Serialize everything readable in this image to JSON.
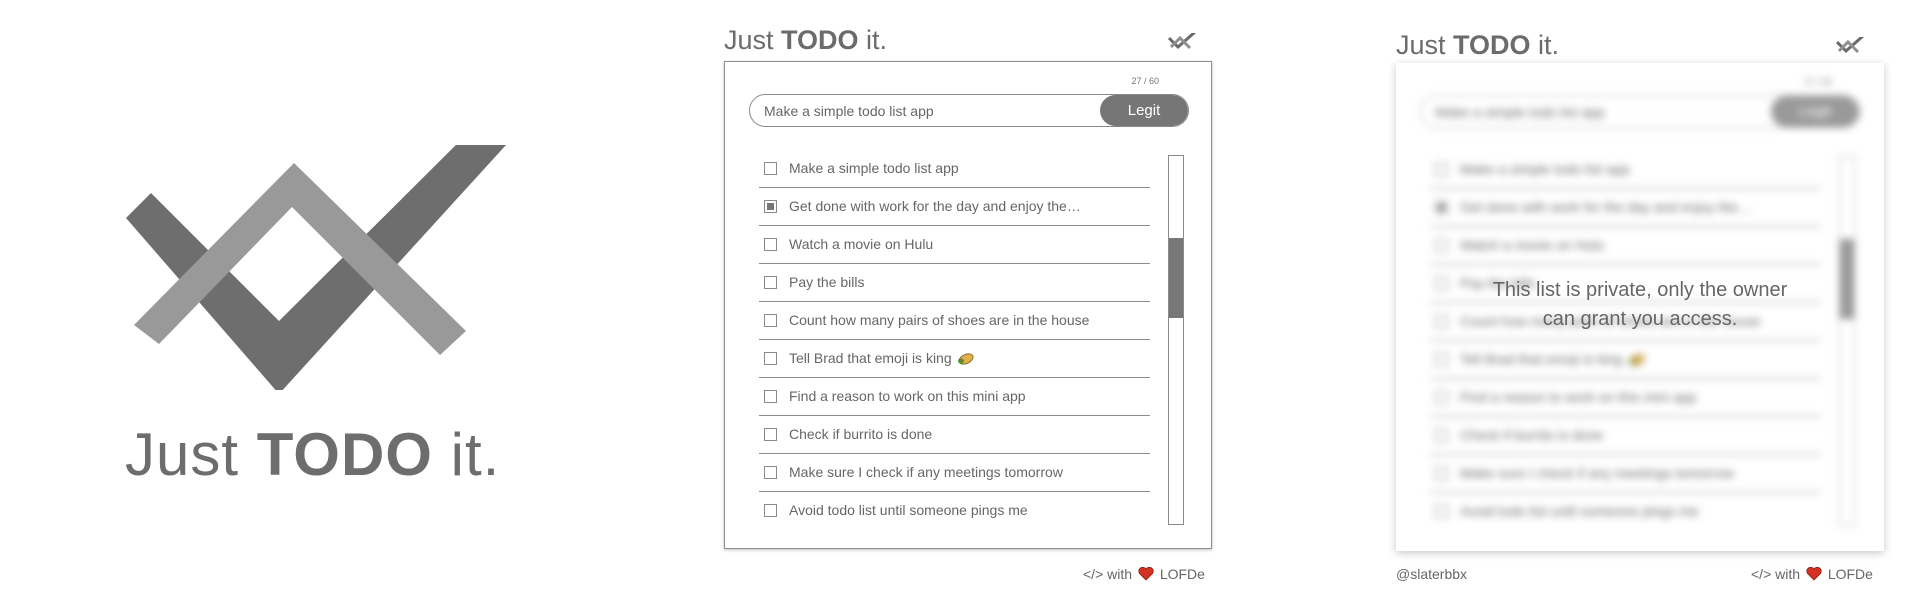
{
  "hero": {
    "title_pre": "Just ",
    "title_bold": "TODO",
    "title_post": " it."
  },
  "panels": {
    "title_pre": "Just ",
    "title_bold": "TODO",
    "title_post": " it."
  },
  "todo": {
    "counter": "27 / 60",
    "input_placeholder": "Make a simple todo list app",
    "submit_label": "Legit",
    "items": [
      {
        "text": "Make a simple todo list app",
        "checked": false
      },
      {
        "text": "Get done with work for the day and enjoy the…",
        "checked": true
      },
      {
        "text": "Watch a movie on Hulu",
        "checked": false
      },
      {
        "text": "Pay the bills",
        "checked": false
      },
      {
        "text": "Count how many pairs of shoes are in the house",
        "checked": false
      },
      {
        "text": "Tell Brad that emoji is king",
        "checked": false,
        "emoji": "burrito-emoji"
      },
      {
        "text": "Find a reason to work on this mini app",
        "checked": false
      },
      {
        "text": "Check if burrito is done",
        "checked": false
      },
      {
        "text": "Make sure I check if any meetings tomorrow",
        "checked": false
      },
      {
        "text": "Avoid todo list until someone pings me",
        "checked": false
      }
    ],
    "scroll_position": 0.22
  },
  "private_message": "This list is private, only the owner can grant you access.",
  "footer": {
    "credit_pre": "</> with",
    "credit_post": "LOFDe",
    "handle": "@slaterbbx"
  },
  "colors": {
    "logo_dark": "#6e6e6e",
    "logo_light": "#9a9a9a",
    "heart": "#d2321f"
  }
}
